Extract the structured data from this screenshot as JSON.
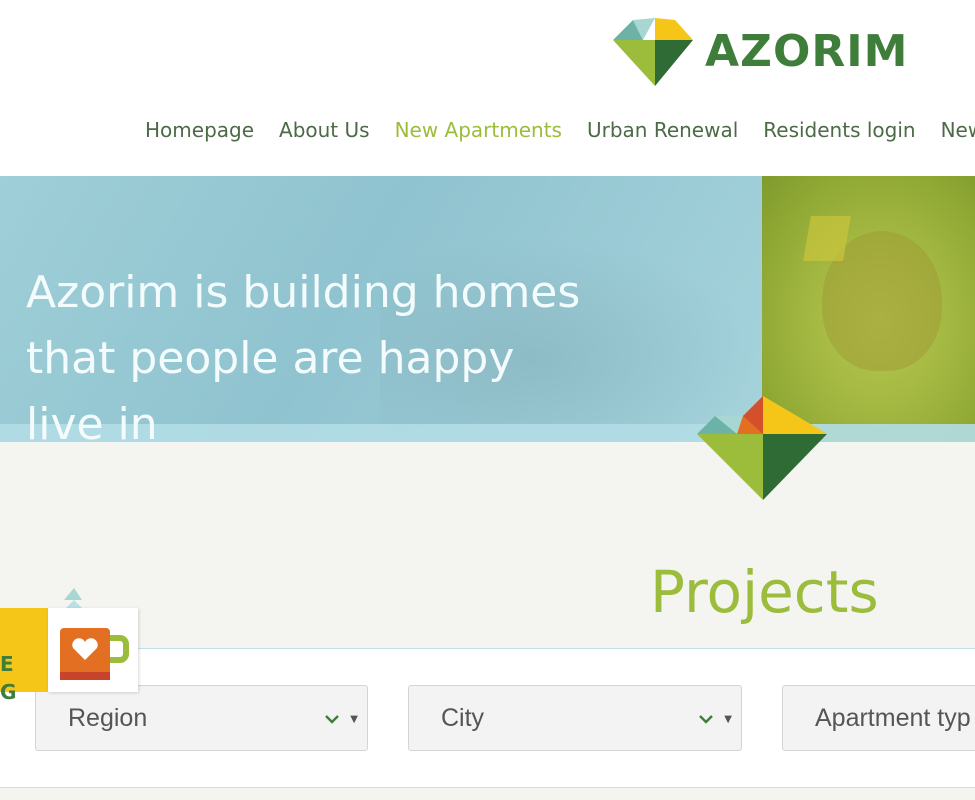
{
  "header": {
    "logo_text": "AZORIM",
    "nav": [
      "Homepage",
      "About Us",
      "New Apartments",
      "Urban Renewal",
      "Residents login",
      "New"
    ],
    "active_nav": "New Apartments"
  },
  "hero": {
    "title_lines": [
      "Azorim is building homes",
      "that people are happy",
      "live in"
    ]
  },
  "projects": {
    "title": "Projects",
    "filters": {
      "region": "Region",
      "city": "City",
      "apartment_type": "Apartment typ"
    }
  },
  "badge": {
    "letters": [
      "E",
      "G"
    ]
  },
  "colors": {
    "brand_green": "#3f7d3a",
    "accent_lime": "#9cbc3c",
    "hero_blue": "#9fcfd8",
    "badge_yellow": "#f5c518",
    "orange": "#e36f22"
  },
  "icons": {
    "logo": "azorim-diamond-logo",
    "chevron": "chevron-down-icon",
    "badge": "coffee-mug-heart-icon"
  }
}
